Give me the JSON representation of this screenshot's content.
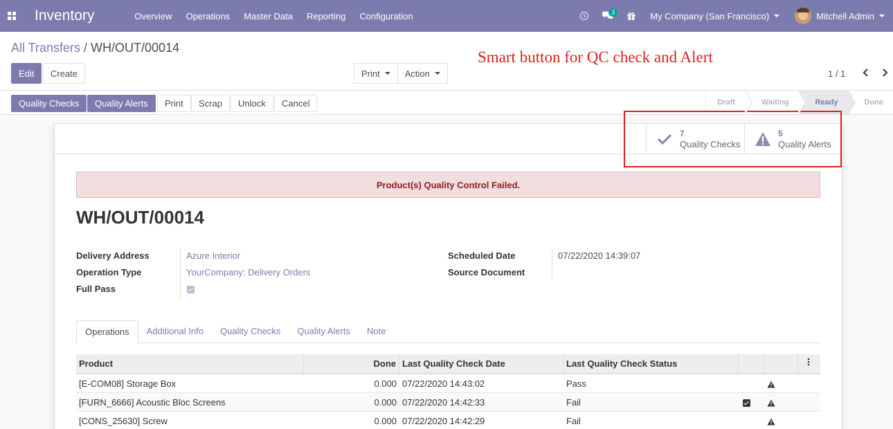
{
  "navbar": {
    "app_name": "Inventory",
    "menu": [
      "Overview",
      "Operations",
      "Master Data",
      "Reporting",
      "Configuration"
    ],
    "messages_count": "3",
    "company": "My Company (San Francisco)",
    "user": "Mitchell Admin",
    "bg_color": "#7c7bad"
  },
  "breadcrumb": {
    "parent": "All Transfers",
    "separator": "/",
    "current": "WH/OUT/00014"
  },
  "buttons": {
    "edit": "Edit",
    "create": "Create",
    "print": "Print",
    "action": "Action"
  },
  "annotation": "Smart button for QC check and Alert",
  "pager": {
    "value": "1 / 1"
  },
  "statusbar": {
    "buttons": [
      "Quality Checks",
      "Quality Alerts",
      "Print",
      "Scrap",
      "Unlock",
      "Cancel"
    ],
    "stages": [
      "Draft",
      "Waiting",
      "Ready",
      "Done"
    ],
    "active_stage": "Ready"
  },
  "smart_buttons": [
    {
      "value": "7",
      "label": "Quality Checks",
      "icon": "check-icon"
    },
    {
      "value": "5",
      "label": "Quality Alerts",
      "icon": "warning-icon"
    }
  ],
  "alert": "Product(s) Quality Control Failed.",
  "record_title": "WH/OUT/00014",
  "fields": {
    "delivery_address": {
      "label": "Delivery Address",
      "value": "Azure Interior"
    },
    "operation_type": {
      "label": "Operation Type",
      "value": "YourCompany: Delivery Orders"
    },
    "full_pass": {
      "label": "Full Pass",
      "checked": true
    },
    "scheduled_date": {
      "label": "Scheduled Date",
      "value": "07/22/2020 14:39:07"
    },
    "source_document": {
      "label": "Source Document",
      "value": ""
    }
  },
  "tabs": [
    "Operations",
    "Additional Info",
    "Quality Checks",
    "Quality Alerts",
    "Note"
  ],
  "active_tab": "Operations",
  "table": {
    "headers": [
      "Product",
      "Done",
      "Last Quality Check Date",
      "Last Quality Check Status"
    ],
    "rows": [
      {
        "product": "[E-COM08] Storage Box",
        "done": "0.000",
        "date": "07/22/2020 14:43:02",
        "status": "Pass",
        "checked": false
      },
      {
        "product": "[FURN_6666] Acoustic Bloc Screens",
        "done": "0.000",
        "date": "07/22/2020 14:42:33",
        "status": "Fail",
        "checked": true
      },
      {
        "product": "[CONS_25630] Screw",
        "done": "0.000",
        "date": "07/22/2020 14:42:29",
        "status": "Fail",
        "checked": false
      }
    ]
  }
}
